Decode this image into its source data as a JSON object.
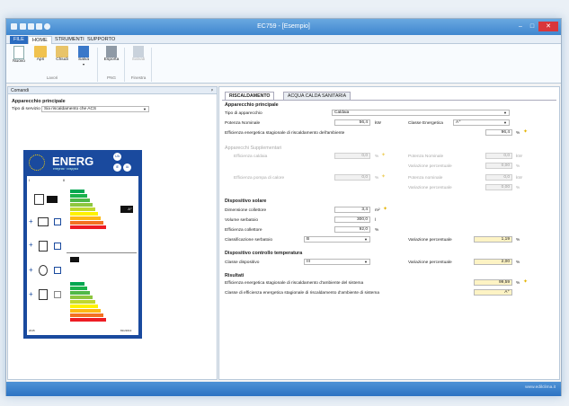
{
  "window": {
    "title": "EC759 - [Esempio]"
  },
  "menu": {
    "file": "FILE",
    "home": "HOME",
    "tools": "STRUMENTI",
    "support": "SUPPORTO"
  },
  "ribbon": {
    "buttons": {
      "new": "Nuovo",
      "open": "Apri",
      "close": "Chiudi",
      "save": "Salva",
      "export": "Esporta",
      "saves": "Salvati"
    },
    "groups": {
      "works": "Lavori",
      "png": "PNG",
      "window": "Finestra"
    }
  },
  "left": {
    "header": "Comandi",
    "pin": "ᵖ",
    "section": "Apparecchio principale",
    "service_label": "Tipo di servizio",
    "service_value": "Sia riscaldamento che ACS",
    "label_title": "ENERG",
    "label_subtitle": "енергия · ενεργεια",
    "label_badges": [
      "UA",
      "IE",
      "IA"
    ],
    "label_roman_1": "I",
    "label_roman_2": "II",
    "label_footer_left": "2015",
    "label_footer_right": "811/2013",
    "label_arrow": "A⁺"
  },
  "tabs": {
    "heating": "RISCALDAMENTO",
    "hot_water": "ACQUA CALDA SANITARIA"
  },
  "main": {
    "app": {
      "title": "Apparecchio principale",
      "type_label": "Tipo di apparecchio",
      "type_value": "Caldaia",
      "power_label": "Potenza Nominale",
      "power_value": "56,4",
      "power_unit": "kW",
      "class_label": "Classe Energetica",
      "class_value": "A⁺",
      "eff_label": "Efficienza energetica stagionale di riscaldamento dell'ambiente",
      "eff_value": "96,4",
      "eff_unit": "%"
    },
    "supp": {
      "title": "Apparecchi Supplementari",
      "boiler_label": "Efficienza caldaia",
      "boiler_value": "0,0",
      "pump_label": "Efficienza pompa di calore",
      "pump_value": "0,0",
      "unit": "%",
      "pn_label_1": "Potenza Nominale",
      "pn_value_1": "0,0",
      "var_label_1": "Variazione percentuale",
      "var_value_1": "0,00",
      "pn_label_2": "Potenza nominale",
      "pn_value_2": "0,0",
      "var_label_2": "Variazione percentuale",
      "var_value_2": "0,00",
      "kw": "kW"
    },
    "solar": {
      "title": "Dispositivo solare",
      "collector_label": "Dimensione collettore",
      "collector_value": "3,4",
      "collector_unit": "m²",
      "tank_label": "Volume serbatoio",
      "tank_value": "300,0",
      "tank_unit": "l",
      "coll_eff_label": "Efficienza collettore",
      "coll_eff_value": "92,0",
      "coll_eff_unit": "%",
      "tank_class_label": "Classificazione serbatoio",
      "tank_class_value": "B",
      "var_label": "Variazione percentuale",
      "var_value": "1,19",
      "var_unit": "%"
    },
    "temp": {
      "title": "Dispositivo controllo temperatura",
      "class_label": "Classe dispositivo",
      "class_value": "III",
      "var_label": "Variazione percentuale",
      "var_value": "2,00",
      "var_unit": "%"
    },
    "results": {
      "title": "Risultati",
      "sys_eff_label": "Efficienza energetica stagionale di riscaldamento d'ambiente del sistema",
      "sys_eff_value": "99,59",
      "sys_eff_unit": "%",
      "sys_class_label": "Classe di efficienza energetica stagionale di riscaldamento d'ambiente di sistema",
      "sys_class_value": "A⁺"
    }
  },
  "footer": {
    "brand": "www.edilclima.it"
  },
  "colors": {
    "accent": "#2b6cc0",
    "title_bar": "#4a90d9",
    "highlight": "#fdf3c4",
    "bulb": "#e4b300",
    "label_blue": "#1a4a9e",
    "close": "#d9363b"
  }
}
